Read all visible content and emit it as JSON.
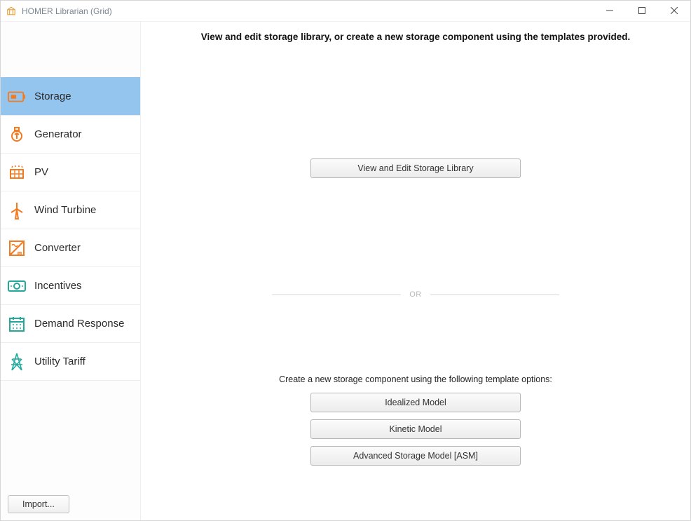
{
  "window": {
    "title": "HOMER Librarian (Grid)"
  },
  "header": {
    "intro": "View and edit storage library, or create a new storage component using the templates provided."
  },
  "sidebar": {
    "items": [
      {
        "label": "Storage",
        "icon": "battery-icon",
        "active": true
      },
      {
        "label": "Generator",
        "icon": "generator-icon",
        "active": false
      },
      {
        "label": "PV",
        "icon": "pv-icon",
        "active": false
      },
      {
        "label": "Wind Turbine",
        "icon": "wind-icon",
        "active": false
      },
      {
        "label": "Converter",
        "icon": "converter-icon",
        "active": false
      },
      {
        "label": "Incentives",
        "icon": "money-icon",
        "active": false
      },
      {
        "label": "Demand Response",
        "icon": "calendar-icon",
        "active": false
      },
      {
        "label": "Utility Tariff",
        "icon": "tower-icon",
        "active": false
      }
    ],
    "import_label": "Import..."
  },
  "main": {
    "view_edit_button": "View and Edit Storage Library",
    "or_label": "OR",
    "template_prompt": "Create a new storage component using the following template options:",
    "template_buttons": [
      "Idealized Model",
      "Kinetic Model",
      "Advanced Storage Model [ASM]"
    ]
  },
  "colors": {
    "accent_orange": "#f47a20",
    "accent_teal": "#22a99a",
    "sidebar_active": "#94c5ee"
  }
}
